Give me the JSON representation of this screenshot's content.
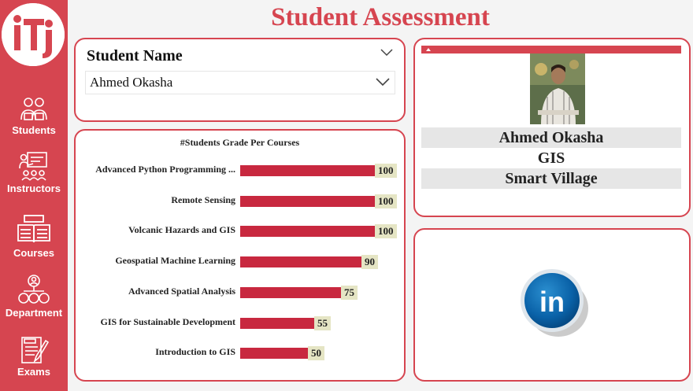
{
  "page_title": "Student Assessment",
  "sidebar": {
    "logo_text": "iTi",
    "items": [
      {
        "label": "Students",
        "icon": "students-icon"
      },
      {
        "label": "Instructors",
        "icon": "instructors-icon"
      },
      {
        "label": "Courses",
        "icon": "courses-icon"
      },
      {
        "label": "Department",
        "icon": "department-icon"
      },
      {
        "label": "Exams",
        "icon": "exams-icon"
      }
    ]
  },
  "slicer": {
    "title": "Student Name",
    "selected": "Ahmed Okasha"
  },
  "profile": {
    "name": "Ahmed Okasha",
    "track": "GIS",
    "branch": "Smart Village"
  },
  "linkedin": {
    "icon_text": "in"
  },
  "colors": {
    "accent": "#d64550",
    "bar": "#c8283f",
    "label_bg": "#e5e5c4"
  },
  "chart_data": {
    "type": "bar",
    "orientation": "horizontal",
    "title": "#Students Grade Per Courses",
    "categories": [
      "Advanced Python Programming ...",
      "Remote Sensing",
      "Volcanic Hazards and GIS",
      "Geospatial Machine Learning",
      "Advanced Spatial Analysis",
      "GIS for Sustainable Development",
      "Introduction to GIS"
    ],
    "values": [
      100,
      100,
      100,
      90,
      75,
      55,
      50
    ],
    "xlim": [
      0,
      100
    ]
  }
}
